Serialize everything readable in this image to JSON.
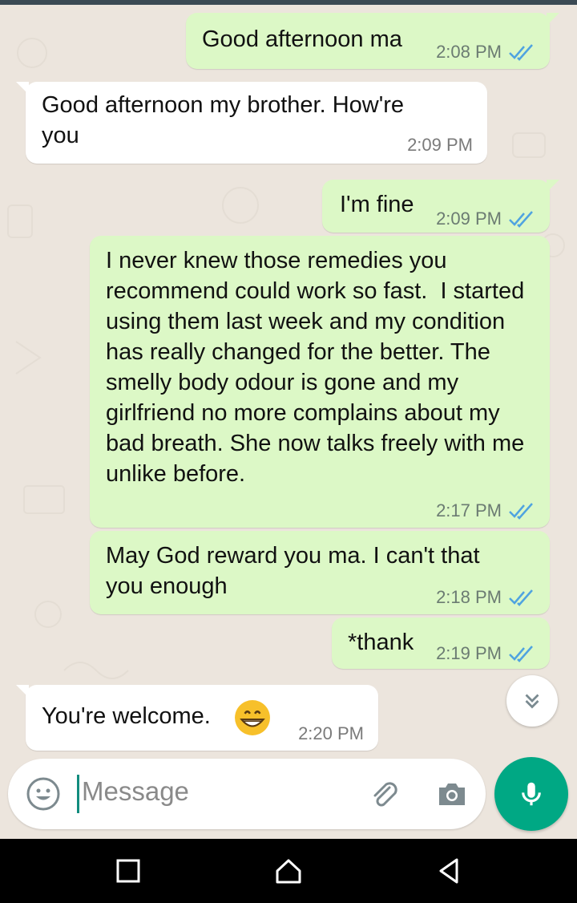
{
  "messages": [
    {
      "id": "m1",
      "dir": "out",
      "text": "Good afternoon ma",
      "time": "2:08 PM",
      "status": "read"
    },
    {
      "id": "m2",
      "dir": "in",
      "text": "Good afternoon my brother. How're you",
      "time": "2:09 PM"
    },
    {
      "id": "m3",
      "dir": "out",
      "text": "I'm fine",
      "time": "2:09 PM",
      "status": "read"
    },
    {
      "id": "m4",
      "dir": "out",
      "text": "I never knew those remedies you recommend could work so fast.  I started using them last week and my condition has really changed for the better. The smelly body odour is gone and my girlfriend no more complains about my bad breath. She now talks freely with me unlike before.",
      "time": "2:17 PM",
      "status": "read"
    },
    {
      "id": "m5",
      "dir": "out",
      "text": "May God reward you ma. I can't that you enough",
      "time": "2:18 PM",
      "status": "read"
    },
    {
      "id": "m6",
      "dir": "out",
      "text": "*thank",
      "time": "2:19 PM",
      "status": "read"
    },
    {
      "id": "m7",
      "dir": "in",
      "text": "You're welcome.",
      "emoji": "grinning-face",
      "time": "2:20 PM"
    }
  ],
  "composer": {
    "placeholder": "Message"
  },
  "colors": {
    "outgoing": "#dcf8c6",
    "incoming": "#ffffff",
    "accent": "#00a884",
    "read_ticks": "#4fa3e0"
  },
  "icons": {
    "emoji": "smiley-icon",
    "attach": "paperclip-icon",
    "camera": "camera-icon",
    "mic": "microphone-icon",
    "scroll": "double-chevron-down-icon",
    "nav": [
      "recents-square-icon",
      "home-icon",
      "back-icon"
    ]
  }
}
